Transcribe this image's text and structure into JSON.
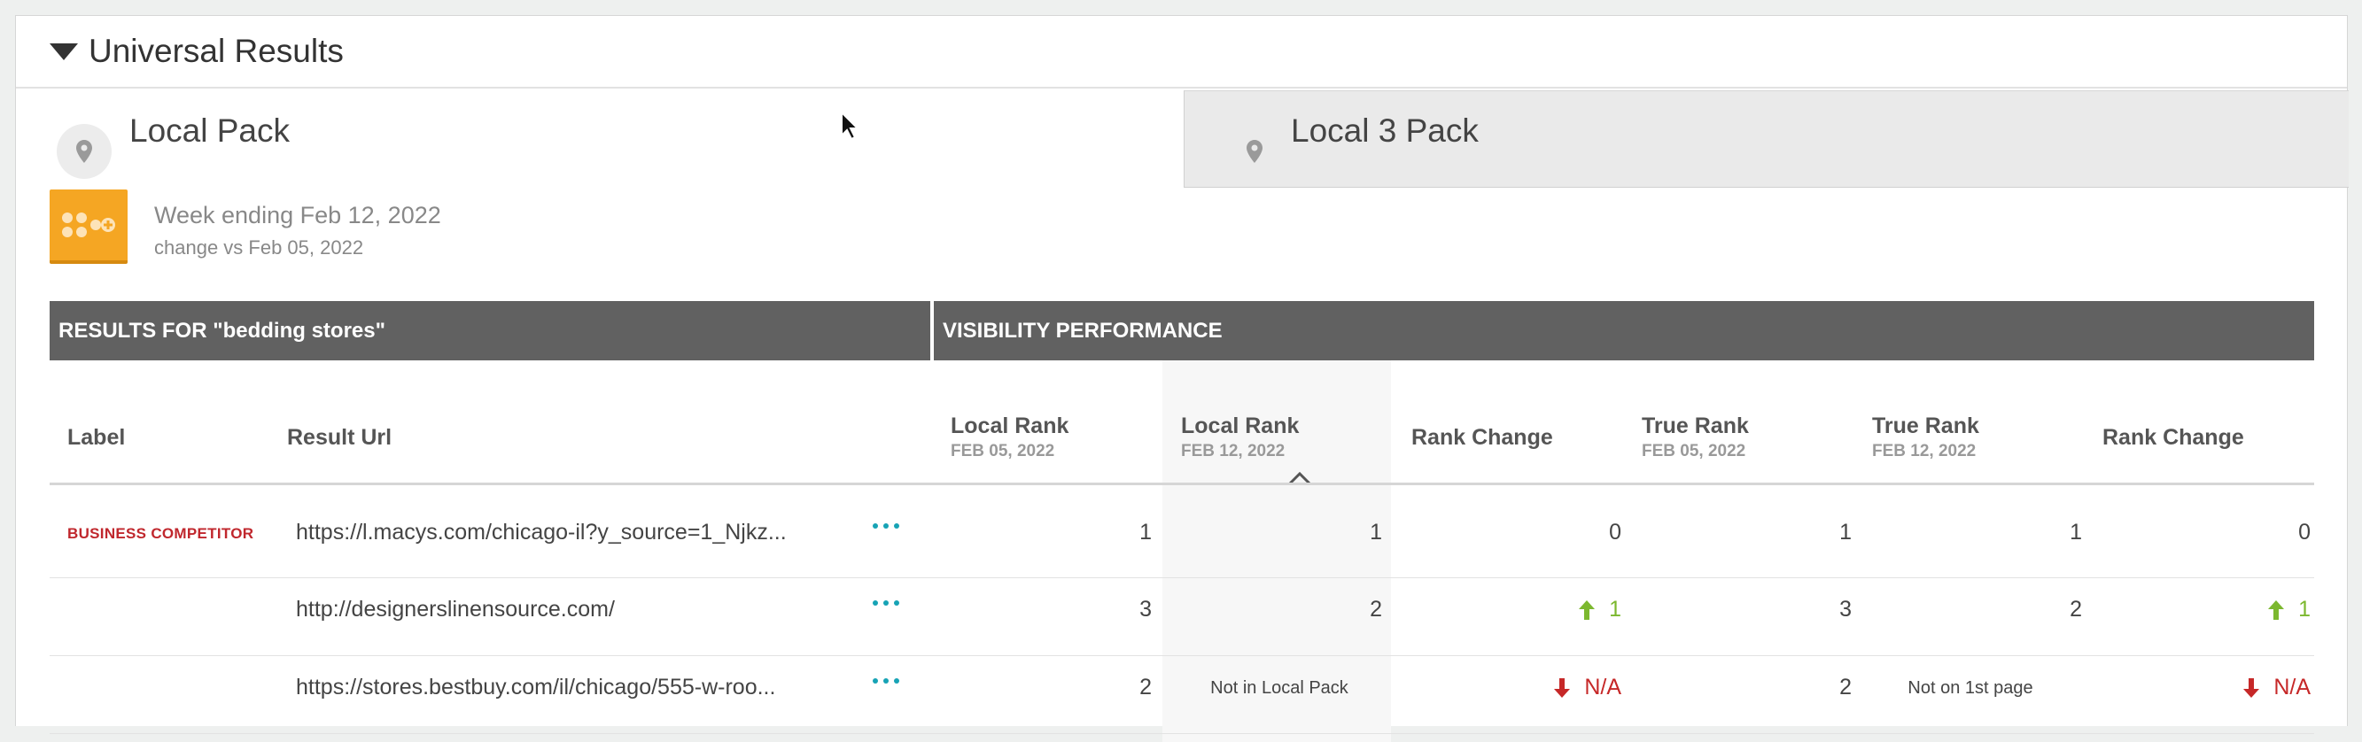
{
  "section": {
    "title": "Universal Results"
  },
  "tabs": [
    {
      "label": "Local Pack",
      "active": true,
      "icon": "map-pin-icon"
    },
    {
      "label": "Local 3 Pack",
      "active": false,
      "icon": "map-pin-icon"
    }
  ],
  "week": {
    "ending": "Week ending Feb 12, 2022",
    "change": "change vs Feb 05, 2022",
    "logo_color": "#f5a623"
  },
  "table": {
    "group_results": "RESULTS FOR \"bedding stores\"",
    "group_visibility": "VISIBILITY PERFORMANCE",
    "columns": {
      "label": "Label",
      "url": "Result Url",
      "local_rank_prev": {
        "title": "Local Rank",
        "date": "FEB 05, 2022"
      },
      "local_rank_cur": {
        "title": "Local Rank",
        "date": "FEB 12, 2022",
        "sorted": true
      },
      "local_change": {
        "title": "Rank Change"
      },
      "true_rank_prev": {
        "title": "True Rank",
        "date": "FEB 05, 2022"
      },
      "true_rank_cur": {
        "title": "True Rank",
        "date": "FEB 12, 2022"
      },
      "true_change": {
        "title": "Rank Change"
      }
    },
    "rows": [
      {
        "label": "BUSINESS COMPETITOR",
        "url": "https://l.macys.com/chicago-il?y_source=1_Njkz...",
        "local_prev": "1",
        "local_cur": "1",
        "local_change": "0",
        "local_change_dir": "none",
        "true_prev": "1",
        "true_cur": "1",
        "true_change": "0",
        "true_change_dir": "none"
      },
      {
        "label": "",
        "url": "http://designerslinensource.com/",
        "local_prev": "3",
        "local_cur": "2",
        "local_change": "1",
        "local_change_dir": "up",
        "true_prev": "3",
        "true_cur": "2",
        "true_change": "1",
        "true_change_dir": "up"
      },
      {
        "label": "",
        "url": "https://stores.bestbuy.com/il/chicago/555-w-roo...",
        "local_prev": "2",
        "local_cur": "Not in Local Pack",
        "local_change": "N/A",
        "local_change_dir": "down",
        "true_prev": "2",
        "true_cur": "Not on 1st page",
        "true_change": "N/A",
        "true_change_dir": "down"
      }
    ]
  },
  "colors": {
    "up": "#7cb82f",
    "down": "#c62828",
    "badge": "#c0272d",
    "header_bg": "#616161",
    "more": "#17a3b5"
  }
}
